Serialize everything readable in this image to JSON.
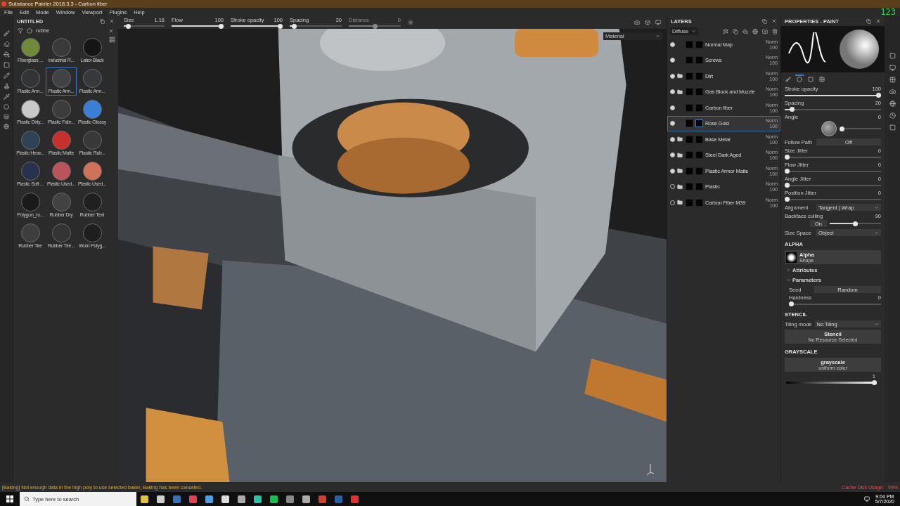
{
  "window": {
    "title": "Substance Painter 2018.3.3 - Carbon fiber"
  },
  "menu": [
    "File",
    "Edit",
    "Mode",
    "Window",
    "Viewport",
    "Plugins",
    "Help"
  ],
  "frame_counter": "123",
  "toolbar": {
    "sliders": [
      {
        "label": "Size",
        "value": "1.16",
        "level": 0.05,
        "disabled": false
      },
      {
        "label": "Flow",
        "value": "100",
        "level": 1,
        "disabled": false
      },
      {
        "label": "Stroke opacity",
        "value": "100",
        "level": 1,
        "disabled": false
      },
      {
        "label": "Spacing",
        "value": "20",
        "level": 0.05,
        "disabled": false
      },
      {
        "label": "Distance",
        "value": "0",
        "level": 0.5,
        "disabled": true
      }
    ]
  },
  "shelf": {
    "title": "UNTITLED",
    "search": "rubbe",
    "items": [
      {
        "name": "Fiberglass ...",
        "color": "#6f8a3a",
        "selected": false
      },
      {
        "name": "Industrial R...",
        "color": "#3a3a3a",
        "selected": false
      },
      {
        "name": "Latex Black",
        "color": "#151515",
        "selected": false
      },
      {
        "name": "Plastic Arm...",
        "color": "#333438",
        "selected": false
      },
      {
        "name": "Plastic Arm...",
        "color": "#404246",
        "selected": true
      },
      {
        "name": "Plastic Arm...",
        "color": "#37383b",
        "selected": false
      },
      {
        "name": "Plastic Dirty...",
        "color": "#c9c9c9",
        "selected": false
      },
      {
        "name": "Plastic Fabr...",
        "color": "#3c3c3c",
        "selected": false
      },
      {
        "name": "Plastic Glossy",
        "color": "#3a7fd6",
        "selected": false
      },
      {
        "name": "Plastic Heav...",
        "color": "#2f4256",
        "selected": false
      },
      {
        "name": "Plastic Matte",
        "color": "#c8302e",
        "selected": false
      },
      {
        "name": "Plastic Rub...",
        "color": "#383838",
        "selected": false
      },
      {
        "name": "Plastic Soft ...",
        "color": "#27324c",
        "selected": false
      },
      {
        "name": "Plastic Used...",
        "color": "#b9545c",
        "selected": false
      },
      {
        "name": "Plastic Used...",
        "color": "#d07258",
        "selected": false
      },
      {
        "name": "Polygon_ru...",
        "color": "#1a1a1a",
        "selected": false
      },
      {
        "name": "Rubber Dry",
        "color": "#424242",
        "selected": false
      },
      {
        "name": "Rubber Text",
        "color": "#202020",
        "selected": false
      },
      {
        "name": "Rubber Tire",
        "color": "#3e3e3e",
        "selected": false
      },
      {
        "name": "Rubber Tire...",
        "color": "#343434",
        "selected": false
      },
      {
        "name": "Worn Polyg...",
        "color": "#1e1e1e",
        "selected": false
      }
    ]
  },
  "viewport": {
    "channel": "Material"
  },
  "layers": {
    "title": "LAYERS",
    "channel": "Diffuse",
    "items": [
      {
        "name": "Normal Map",
        "kind": "layer",
        "visible": true,
        "selected": false,
        "blend": "Norm",
        "opacity": "100"
      },
      {
        "name": "Screws",
        "kind": "layer",
        "visible": true,
        "selected": false,
        "blend": "Norm",
        "opacity": "100"
      },
      {
        "name": "Dirt",
        "kind": "folder",
        "visible": true,
        "selected": false,
        "blend": "Norm",
        "opacity": "100"
      },
      {
        "name": "Gas Block and Muzzle",
        "kind": "folder",
        "visible": true,
        "selected": false,
        "blend": "Norm",
        "opacity": "100"
      },
      {
        "name": "Carbon fiber",
        "kind": "layer",
        "visible": true,
        "selected": false,
        "blend": "Norm",
        "opacity": "100"
      },
      {
        "name": "Rose Gold",
        "kind": "layer",
        "visible": true,
        "selected": true,
        "blend": "Norm",
        "opacity": "100"
      },
      {
        "name": "Base Metal",
        "kind": "folder",
        "visible": true,
        "selected": false,
        "blend": "Norm",
        "opacity": "100"
      },
      {
        "name": "Steel Dark Aged",
        "kind": "folder",
        "visible": true,
        "selected": false,
        "blend": "Norm",
        "opacity": "100"
      },
      {
        "name": "Plastic Armor Matte",
        "kind": "folder",
        "visible": true,
        "selected": false,
        "blend": "Norm",
        "opacity": "100"
      },
      {
        "name": "Plastic",
        "kind": "folder",
        "visible": false,
        "selected": false,
        "blend": "Norm",
        "opacity": "100"
      },
      {
        "name": "Carbon Fiber M39",
        "kind": "folder",
        "visible": false,
        "selected": false,
        "blend": "Norm",
        "opacity": "100"
      }
    ]
  },
  "properties": {
    "title": "PROPERTIES - PAINT",
    "tabs": [
      {
        "selected": false
      },
      {
        "selected": true
      },
      {
        "selected": false
      },
      {
        "selected": false
      }
    ],
    "params": [
      {
        "kind": "slider",
        "label": "Stroke opacity",
        "value": "100",
        "level": 1
      },
      {
        "kind": "slider",
        "label": "Spacing",
        "value": "20",
        "level": 0.05
      },
      {
        "kind": "angle",
        "label": "Angle",
        "value": "0",
        "level": 0
      },
      {
        "kind": "toggle",
        "label": "Follow Path",
        "value": "Off"
      },
      {
        "kind": "slider",
        "label": "Size Jitter",
        "value": "0",
        "level": 0
      },
      {
        "kind": "slider",
        "label": "Flow Jitter",
        "value": "0",
        "level": 0
      },
      {
        "kind": "slider",
        "label": "Angle Jitter",
        "value": "0",
        "level": 0
      },
      {
        "kind": "slider",
        "label": "Position Jitter",
        "value": "0",
        "level": 0
      },
      {
        "kind": "select",
        "label": "Alignment",
        "value": "Tangent | Wrap"
      },
      {
        "kind": "toggle_slider",
        "label": "Backface culling",
        "value": "On",
        "reading": "90",
        "level": 0.5
      },
      {
        "kind": "select",
        "label": "Size Space",
        "value": "Object"
      }
    ],
    "alpha": {
      "heading": "ALPHA",
      "name": "Alpha",
      "type": "Shape",
      "groups": [
        {
          "label": "Attributes",
          "expanded": false
        },
        {
          "label": "Parameters",
          "expanded": true
        }
      ],
      "seed_label": "Seed",
      "seed_value": "Random",
      "hardness": {
        "label": "Hardness",
        "value": "0",
        "level": 0
      }
    },
    "stencil": {
      "heading": "STENCIL",
      "tiling_label": "Tiling mode",
      "tiling_value": "No Tiling",
      "title": "Stencil",
      "subtitle": "No Resource Selected"
    },
    "grayscale": {
      "heading": "GRAYSCALE",
      "title": "grayscale",
      "subtitle": "uniform color",
      "value": "1",
      "level": 1
    }
  },
  "status_bar": {
    "message": "[Baking] Not enough data in the high poly to use selected baker, Baking has been canceled.",
    "cache": "Cache Disk Usage:   99%"
  },
  "taskbar": {
    "search_placeholder": "Type here to search",
    "time": "9:04 PM",
    "date": "5/7/2020"
  }
}
